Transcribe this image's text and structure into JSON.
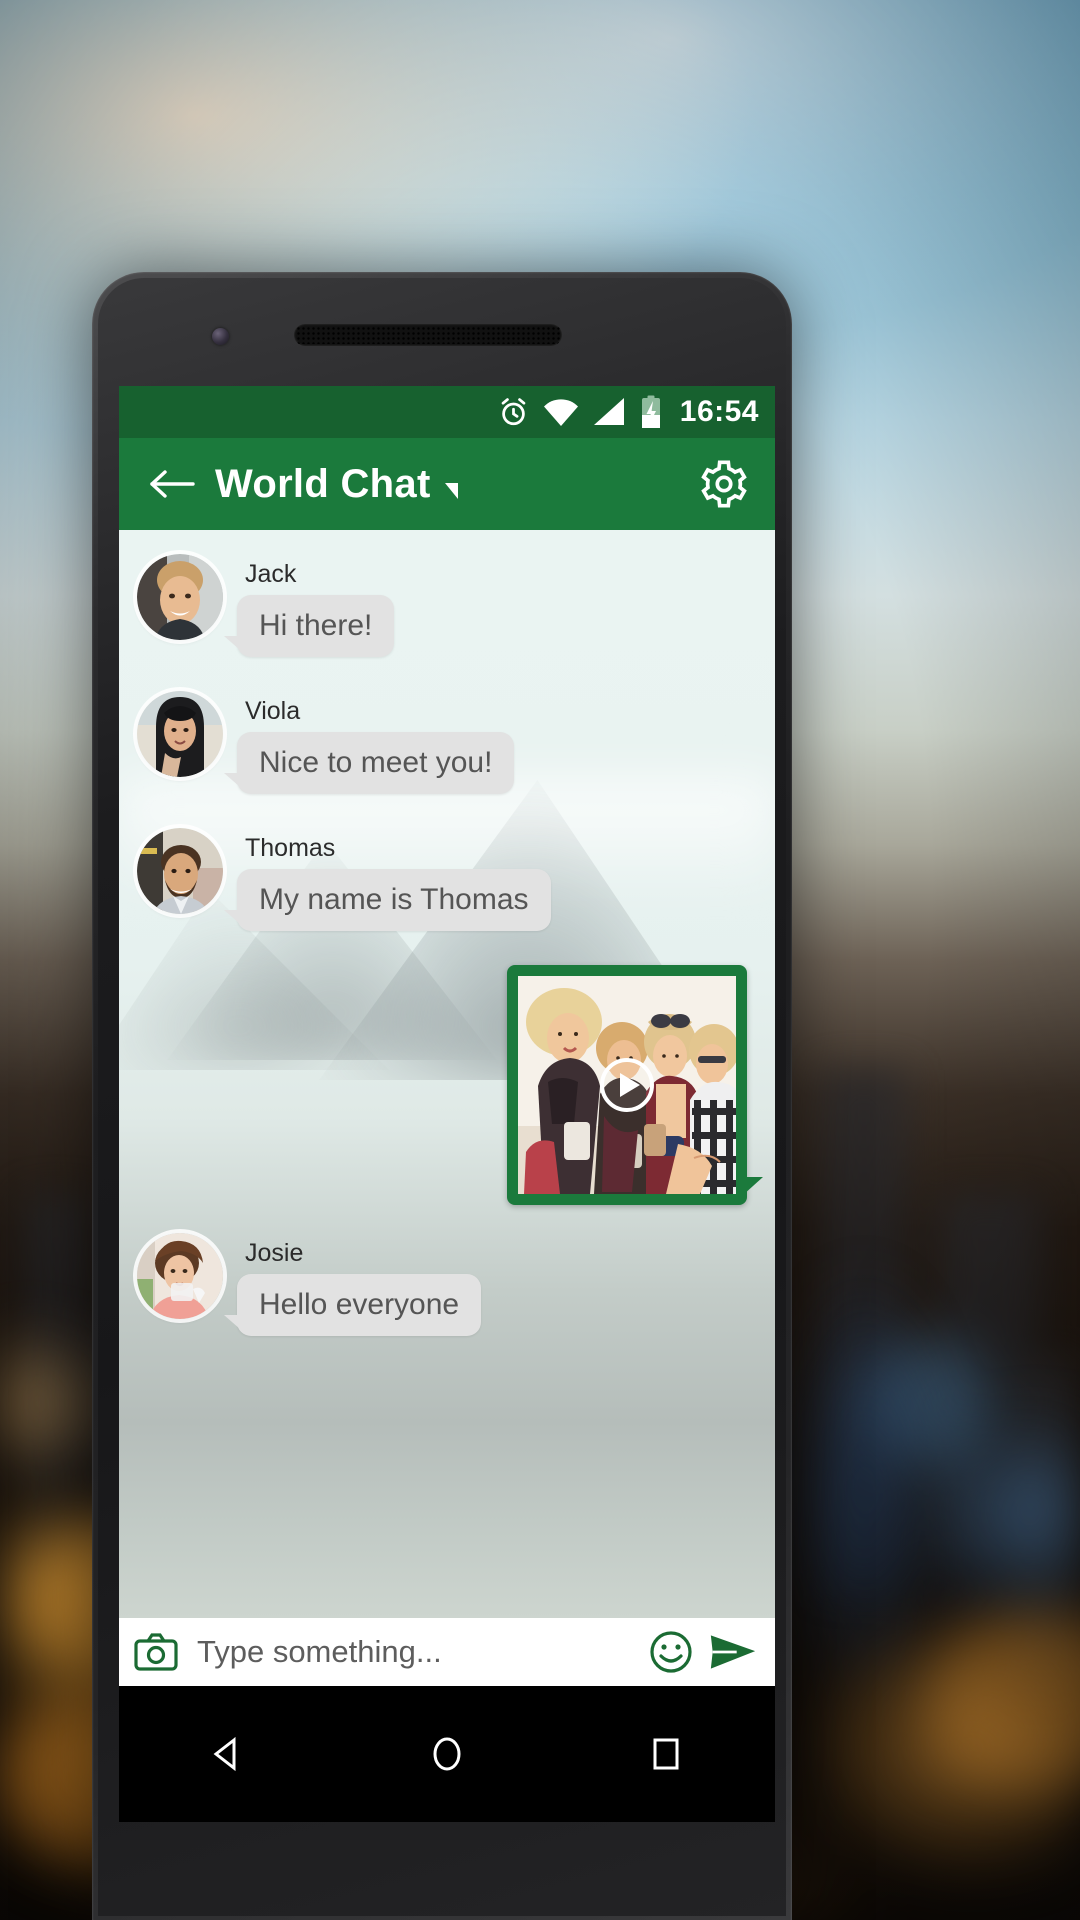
{
  "status_bar": {
    "time": "16:54",
    "icons": [
      "alarm-icon",
      "wifi-icon",
      "signal-icon",
      "battery-charging-icon"
    ]
  },
  "app_bar": {
    "back_icon": "back-arrow-icon",
    "title": "World Chat",
    "dropdown_icon": "dropdown-caret-icon",
    "settings_icon": "gear-icon",
    "bg_color": "#1b7a3c"
  },
  "theme": {
    "primary": "#1b7a3c",
    "status_bar": "#17612f",
    "bubble_bg": "#e2e2e2",
    "bubble_text": "#555555",
    "chat_bg": "#e8f2f0"
  },
  "chat": {
    "messages": [
      {
        "sender": "Jack",
        "text": "Hi there!",
        "type": "text"
      },
      {
        "sender": "Viola",
        "text": "Nice to meet you!",
        "type": "text"
      },
      {
        "sender": "Thomas",
        "text": "My name is Thomas",
        "type": "text"
      },
      {
        "sender": "",
        "text": "",
        "type": "video",
        "outgoing": true
      },
      {
        "sender": "Josie",
        "text": "Hello everyone",
        "type": "text"
      }
    ]
  },
  "input_bar": {
    "camera_icon": "camera-icon",
    "placeholder": "Type something...",
    "emoji_icon": "smiley-icon",
    "send_icon": "send-icon"
  },
  "nav_bar": {
    "back": "nav-back-triangle-icon",
    "home": "nav-home-circle-icon",
    "recents": "nav-recents-square-icon"
  }
}
